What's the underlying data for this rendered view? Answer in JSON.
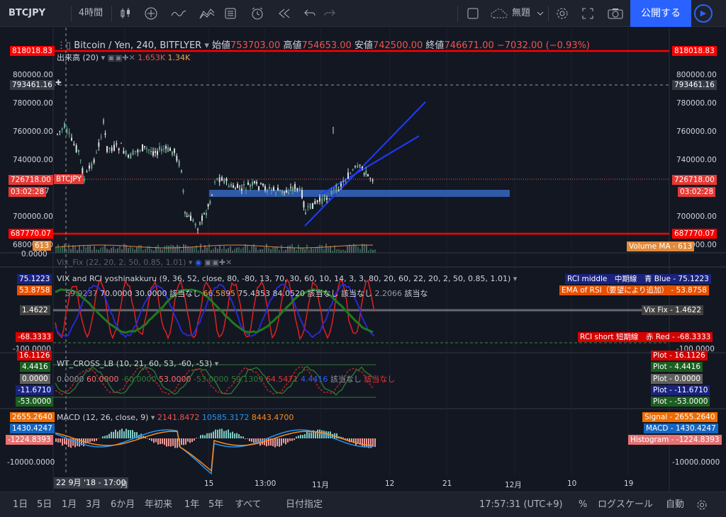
{
  "topbar": {
    "symbol": "BTCJPY",
    "interval": "4時間",
    "theme_label": "無題",
    "publish_label": "公開する"
  },
  "main_legend": {
    "title": "Bitcoin / Yen, 240, BITFLYER",
    "open_label": "始値",
    "open": "753703.00",
    "high_label": "高値",
    "high": "754653.00",
    "low_label": "安値",
    "low": "742500.00",
    "close_label": "終値",
    "close": "746671.00",
    "change": "−7032.00 (−0.93%)"
  },
  "volume_legend": {
    "title": "出来高 (20)",
    "v1": "1.653K",
    "v2": "1.34K"
  },
  "price_axis": {
    "ticks": [
      "800000.00",
      "780000.00",
      "760000.00",
      "740000.00",
      "700000.00",
      "680000.00"
    ],
    "ticks_right": [
      "800000.00",
      "780000.00",
      "760000.00",
      "740000.00",
      "700000.00",
      "680000.00"
    ],
    "hline_top": "818018.83",
    "hline_bottom": "687770.07",
    "crosshair_price": "793461.16",
    "last_price": "726718.00",
    "countdown": "03:02:28",
    "symbol_tag": "BTCJPY",
    "vol_tag": "613",
    "volume_ma": "Volume MA - 613",
    "left_partial": "7"
  },
  "vix_fix_legend": {
    "title": "Vix_Fix (22, 20, 2, 50, 0.85, 1.01)"
  },
  "vix_panel": {
    "legend": "VIX and RCI yoshinakkuru (9, 36, 52, close, 80, -80, 13, 70, 30, 60, 10, 14, 3, 3, 80, 20, 60, 22, 20, 2, 50, 0.85, 1.01)",
    "values": [
      "59.9237",
      "70.0000",
      "30.0000",
      "該当なし",
      "66.5895",
      "75.4353",
      "84.0520",
      "該当なし",
      "該当なし",
      "2.2066",
      "該当な"
    ],
    "left_labels": [
      "75.1223",
      "53.8758",
      "1.4622",
      "-68.3333",
      "-100.0000"
    ],
    "right_labels": {
      "rci_middle": "RCI middle　中期線　青 Blue - 75.1223",
      "ema_rsi": "EMA of RSI（要望により追加） - 53.8758",
      "vix_fix": "Vix Fix - 1.4622",
      "rci_short": "RCI short 短期線　赤 Red - -68.3333",
      "minus100": "-100.0000"
    },
    "zero_label": "0.0000"
  },
  "wt_panel": {
    "legend": "WT_CROSS_LB (10, 21, 60, 53, -60, -53)",
    "values": [
      "0.0000",
      "60.0000",
      "-60.0000",
      "53.0000",
      "-53.0000",
      "59.1309",
      "64.5471",
      "4.4416",
      "該当なし",
      "該当なし"
    ],
    "left_labels": [
      "16.1126",
      "4.4416",
      "0.0000",
      "-11.6710",
      "-53.0000"
    ],
    "right_labels": [
      "Plot - 16.1126",
      "Plot - 4.4416",
      "Plot - 0.0000",
      "Plot - -11.6710",
      "Plot - -53.0000"
    ]
  },
  "macd_panel": {
    "legend": "MACD (12, 26, close, 9)",
    "v1": "2141.8472",
    "v2": "10585.3172",
    "v3": "8443.4700",
    "left_labels": [
      "2655.2640",
      "1430.4247",
      "-1224.8393",
      "-10000.0000"
    ],
    "right_labels": [
      "Signal - 2655.2640",
      "MACD - 1430.4247",
      "Histogram - -1224.8393",
      "-10000.0000"
    ]
  },
  "time_axis": {
    "labels": [
      "月",
      "15",
      "13:00",
      "11月",
      "12",
      "21",
      "12月",
      "10",
      "19"
    ],
    "crosshair_time": "22 9月 '18 - 17:00"
  },
  "bottombar": {
    "ranges": [
      "1日",
      "5日",
      "1月",
      "3月",
      "6か月",
      "年初来",
      "1年",
      "5年",
      "すべて"
    ],
    "goto_date": "日付指定",
    "clock": "17:57:31 (UTC+9)",
    "percent": "%",
    "log": "ログスケール",
    "auto": "自動"
  },
  "colors": {
    "bg": "#131722",
    "red": "#ff0000",
    "blue_channel": "#1e3cff",
    "rect": "#2f5aa8",
    "macd": "#2196f3",
    "signal": "#ff8a1c",
    "up": "#6aa78f",
    "down": "#e0e0e0"
  },
  "chart_data": {
    "type": "candlestick",
    "price_y_range": [
      668000,
      825000
    ],
    "notes_only": ""
  }
}
